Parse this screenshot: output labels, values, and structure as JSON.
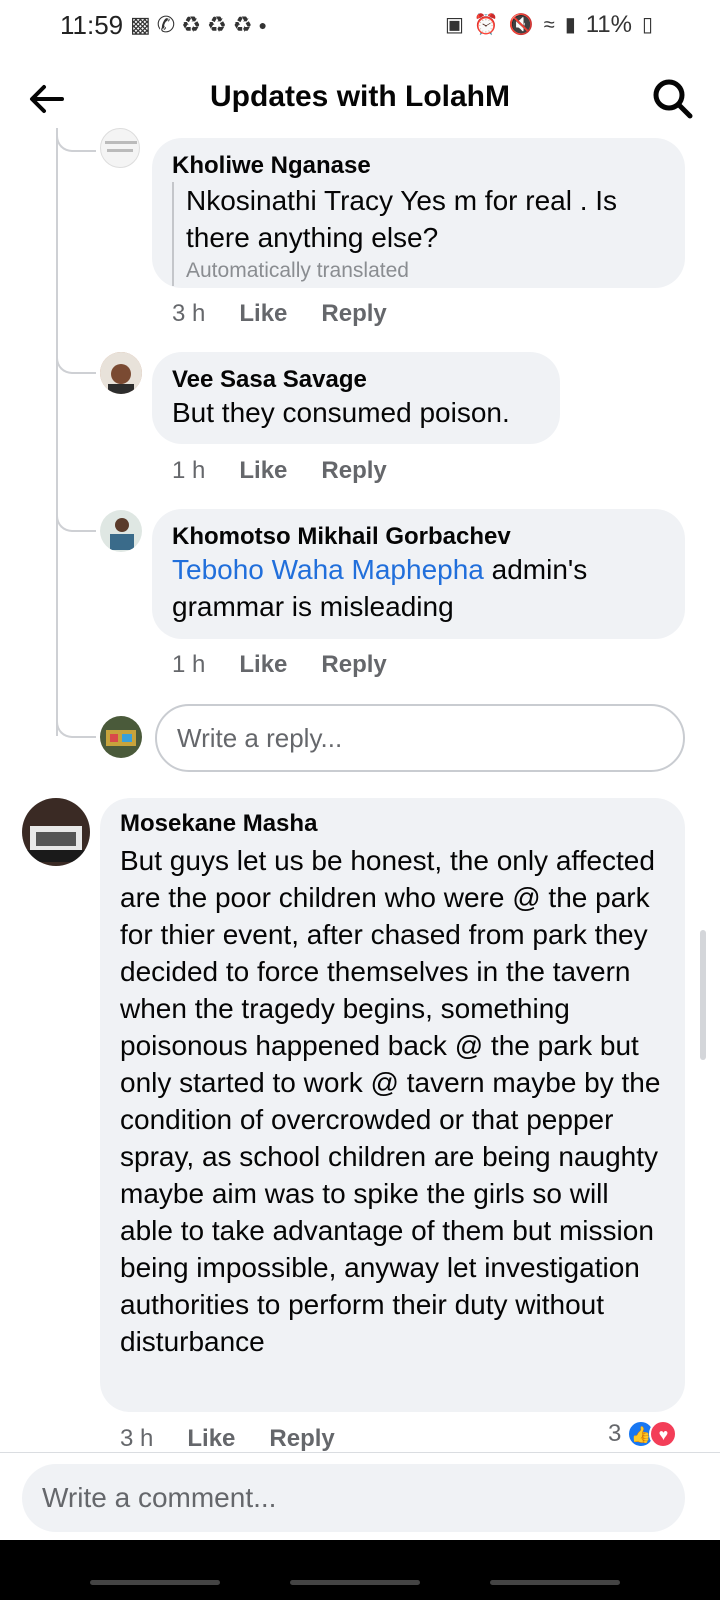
{
  "status_bar": {
    "time": "11:59",
    "left_icons": [
      "message-icon",
      "whatsapp-icon",
      "recycle-icon",
      "recycle-icon",
      "recycle-icon",
      "dot-icon"
    ],
    "battery": "11%"
  },
  "header": {
    "title": "Updates with LolahM"
  },
  "replies": [
    {
      "author": "Kholiwe Nganase",
      "text": "Nkosinathi Tracy Yes m for real . Is there anything else?",
      "translated_note": "Automatically translated",
      "time": "3 h",
      "like": "Like",
      "reply": "Reply"
    },
    {
      "author": "Vee Sasa Savage",
      "text": "But they consumed poison.",
      "time": "1 h",
      "like": "Like",
      "reply": "Reply"
    },
    {
      "author": "Khomotso Mikhail Gorbachev",
      "mention": "Teboho Waha Maphepha",
      "text": " admin's grammar is misleading",
      "time": "1 h",
      "like": "Like",
      "reply": "Reply"
    }
  ],
  "reply_input": {
    "placeholder": "Write a reply..."
  },
  "comment": {
    "author": "Mosekane Masha",
    "text": "But guys let us be honest, the only affected are the poor children who were @ the park for thier event, after chased from park they decided to force themselves in the tavern when the tragedy begins, something poisonous happened back @ the park but only started to work @ tavern maybe by the condition of overcrowded or that pepper spray, as school children are being naughty maybe aim was to spike the girls so will able to take advantage of them but mission being impossible, anyway let investigation authorities to perform their duty without disturbance",
    "time": "3 h",
    "like": "Like",
    "reply": "Reply",
    "reaction_count": "3",
    "reactions": [
      "like-icon",
      "love-icon"
    ]
  },
  "comment_input": {
    "placeholder": "Write a comment..."
  },
  "colors": {
    "bubble": "#f0f2f5",
    "mention": "#216fdb",
    "secondary_text": "#65676b",
    "like_blue": "#1877f2",
    "love_red": "#f33e58"
  }
}
